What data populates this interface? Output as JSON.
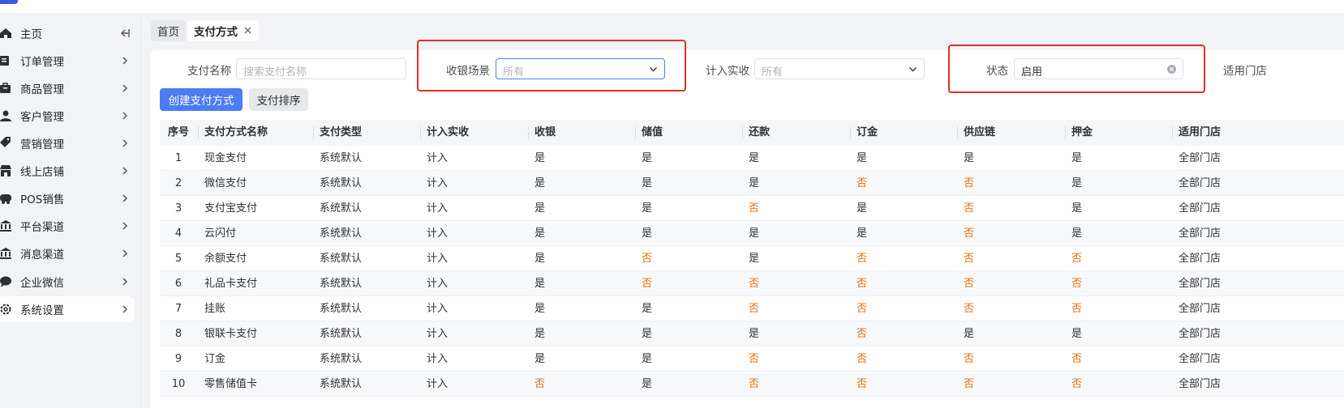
{
  "colors": {
    "accent": "#4c7cf3",
    "negative": "#e8720c",
    "highlight_box": "#e0302a"
  },
  "sidebar": {
    "items": [
      {
        "label": "主页",
        "icon": "home-icon",
        "chevron": "collapse-left-icon",
        "active": false
      },
      {
        "label": "订单管理",
        "icon": "order-icon",
        "chevron": "chevron-right-icon",
        "active": false
      },
      {
        "label": "商品管理",
        "icon": "product-icon",
        "chevron": "chevron-right-icon",
        "active": false
      },
      {
        "label": "客户管理",
        "icon": "user-icon",
        "chevron": "chevron-right-icon",
        "active": false
      },
      {
        "label": "营销管理",
        "icon": "tag-icon",
        "chevron": "chevron-right-icon",
        "active": false
      },
      {
        "label": "线上店铺",
        "icon": "store-icon",
        "chevron": "chevron-right-icon",
        "active": false
      },
      {
        "label": "POS销售",
        "icon": "pos-icon",
        "chevron": "chevron-right-icon",
        "active": false
      },
      {
        "label": "平台渠道",
        "icon": "bank-icon",
        "chevron": "chevron-right-icon",
        "active": false
      },
      {
        "label": "消息渠道",
        "icon": "bank-icon",
        "chevron": "chevron-right-icon",
        "active": false
      },
      {
        "label": "企业微信",
        "icon": "chat-icon",
        "chevron": "chevron-right-icon",
        "active": false
      },
      {
        "label": "系统设置",
        "icon": "gear-icon",
        "chevron": "chevron-right-icon",
        "active": true
      }
    ]
  },
  "tabs": [
    {
      "label": "首页",
      "active": false
    },
    {
      "label": "支付方式",
      "active": true,
      "closable": true
    }
  ],
  "filters": {
    "name": {
      "label": "支付名称",
      "placeholder": "搜索支付名称"
    },
    "scene": {
      "label": "收银场景",
      "placeholder": "所有"
    },
    "actual": {
      "label": "计入实收",
      "placeholder": "所有"
    },
    "status": {
      "label": "状态",
      "value": "启用"
    },
    "store": {
      "label": "适用门店"
    }
  },
  "actions": {
    "create": "创建支付方式",
    "sort": "支付排序"
  },
  "table": {
    "columns": [
      "序号",
      "支付方式名称",
      "支付类型",
      "计入实收",
      "收银",
      "储值",
      "还款",
      "订金",
      "供应链",
      "押金",
      "适用门店"
    ],
    "rows": [
      [
        "1",
        "现金支付",
        "系统默认",
        "计入",
        "是",
        "是",
        "是",
        "是",
        "是",
        "是",
        "全部门店"
      ],
      [
        "2",
        "微信支付",
        "系统默认",
        "计入",
        "是",
        "是",
        "是",
        "否",
        "否",
        "是",
        "全部门店"
      ],
      [
        "3",
        "支付宝支付",
        "系统默认",
        "计入",
        "是",
        "是",
        "否",
        "是",
        "否",
        "是",
        "全部门店"
      ],
      [
        "4",
        "云闪付",
        "系统默认",
        "计入",
        "是",
        "是",
        "是",
        "是",
        "否",
        "是",
        "全部门店"
      ],
      [
        "5",
        "余额支付",
        "系统默认",
        "计入",
        "是",
        "否",
        "是",
        "否",
        "否",
        "否",
        "全部门店"
      ],
      [
        "6",
        "礼品卡支付",
        "系统默认",
        "计入",
        "是",
        "否",
        "否",
        "否",
        "否",
        "否",
        "全部门店"
      ],
      [
        "7",
        "挂账",
        "系统默认",
        "计入",
        "是",
        "是",
        "否",
        "否",
        "否",
        "否",
        "全部门店"
      ],
      [
        "8",
        "银联卡支付",
        "系统默认",
        "计入",
        "是",
        "是",
        "是",
        "否",
        "是",
        "是",
        "全部门店"
      ],
      [
        "9",
        "订金",
        "系统默认",
        "计入",
        "是",
        "是",
        "否",
        "否",
        "否",
        "否",
        "全部门店"
      ],
      [
        "10",
        "零售储值卡",
        "系统默认",
        "计入",
        "否",
        "是",
        "否",
        "否",
        "否",
        "否",
        "全部门店"
      ]
    ]
  }
}
